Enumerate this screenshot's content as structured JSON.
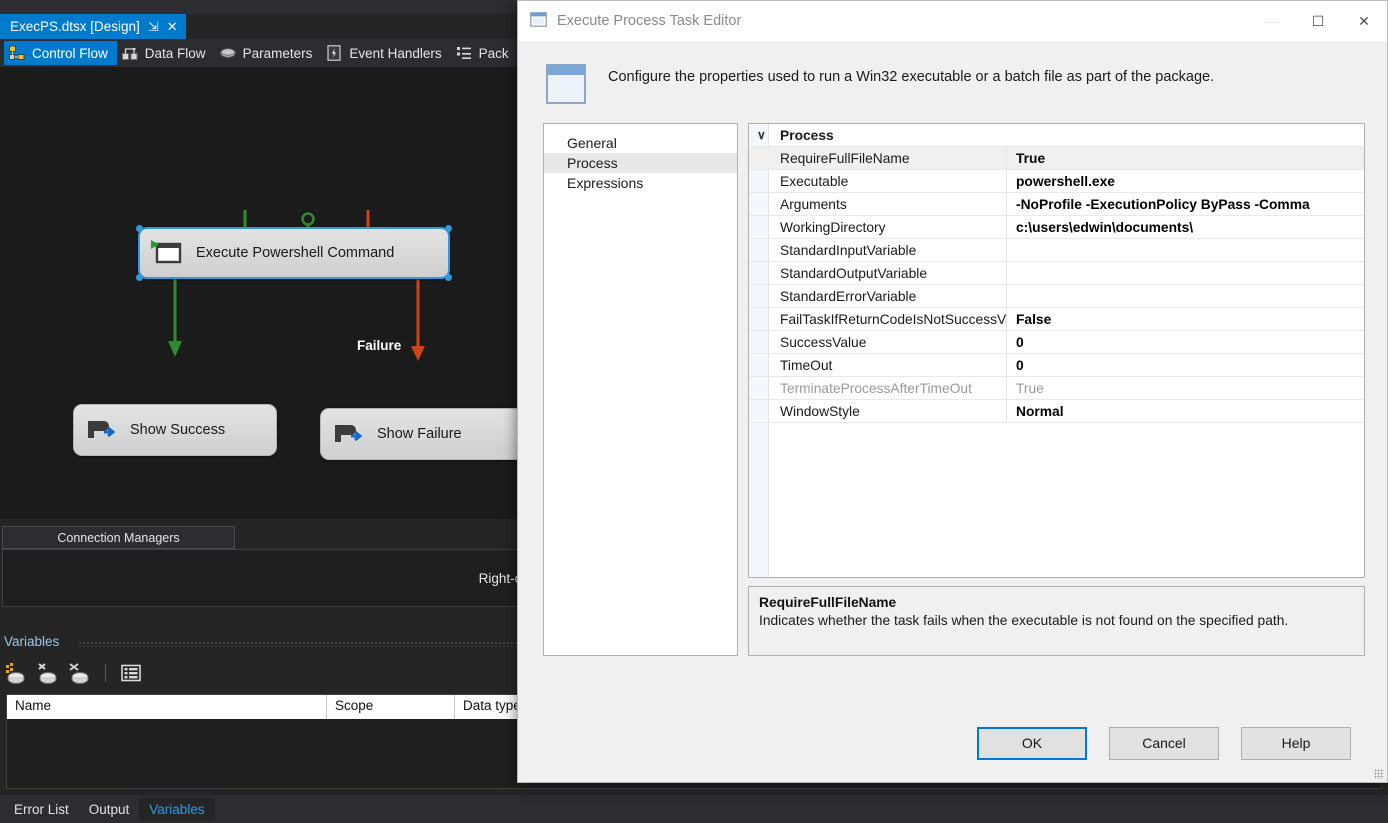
{
  "ide": {
    "document_tab": {
      "title": "ExecPS.dtsx [Design]",
      "pin_glyph": "⇲",
      "close_glyph": "✕"
    },
    "view_tabs": [
      {
        "label": "Control Flow",
        "icon": "control-flow-icon",
        "active": true
      },
      {
        "label": "Data Flow",
        "icon": "data-flow-icon",
        "active": false
      },
      {
        "label": "Parameters",
        "icon": "parameters-icon",
        "active": false
      },
      {
        "label": "Event Handlers",
        "icon": "event-handlers-icon",
        "active": false
      },
      {
        "label": "Pack",
        "icon": "package-explorer-icon",
        "active": false
      }
    ],
    "canvas": {
      "tasks": [
        {
          "label": "Execute Powershell Command",
          "icon": "execute-process-task-icon",
          "selected": true
        },
        {
          "label": "Show Success",
          "icon": "script-task-icon",
          "selected": false
        },
        {
          "label": "Show Failure",
          "icon": "script-task-icon",
          "selected": false
        }
      ],
      "precedence_labels": [
        "Failure"
      ],
      "success_color": "#2e8b2e",
      "failure_color": "#cf4315"
    },
    "connection_managers": {
      "tab_label": "Connection Managers",
      "hint": "Right-click here to add a new connection manager to the SSIS package."
    },
    "variables": {
      "title": "Variables",
      "close_glyph": "✕",
      "toolbar": [
        {
          "name": "add-variable-icon"
        },
        {
          "name": "delete-variable-icon"
        },
        {
          "name": "move-variable-icon"
        },
        {
          "name": "grid-options-icon"
        }
      ],
      "columns": [
        "Name",
        "Scope",
        "Data type"
      ]
    },
    "status_tabs": [
      {
        "label": "Error List",
        "active": false
      },
      {
        "label": "Output",
        "active": false
      },
      {
        "label": "Variables",
        "active": true
      }
    ],
    "gear_icon": "settings-gear-icon",
    "toolbox_icon": "toolbox-panel-icon",
    "accent_color": "#007acc"
  },
  "dialog": {
    "title": "Execute Process Task Editor",
    "title_icon": "window-app-icon",
    "window_controls": {
      "minimize": "—",
      "maximize": "☐",
      "close": "✕"
    },
    "header": {
      "icon": "execute-process-task-large-icon",
      "description": "Configure the properties used to run a Win32 executable or a batch file as part of the package."
    },
    "nav": {
      "items": [
        {
          "label": "General",
          "selected": false
        },
        {
          "label": "Process",
          "selected": true
        },
        {
          "label": "Expressions",
          "selected": false
        }
      ]
    },
    "grid": {
      "category": "Process",
      "collapse_glyph": "∨",
      "rows": [
        {
          "name": "RequireFullFileName",
          "value": "True",
          "selected": true,
          "dim": false
        },
        {
          "name": "Executable",
          "value": "powershell.exe",
          "selected": false,
          "dim": false
        },
        {
          "name": "Arguments",
          "value": "-NoProfile -ExecutionPolicy ByPass -Comma",
          "selected": false,
          "dim": false
        },
        {
          "name": "WorkingDirectory",
          "value": "c:\\users\\edwin\\documents\\",
          "selected": false,
          "dim": false
        },
        {
          "name": "StandardInputVariable",
          "value": "",
          "selected": false,
          "dim": false
        },
        {
          "name": "StandardOutputVariable",
          "value": "",
          "selected": false,
          "dim": false
        },
        {
          "name": "StandardErrorVariable",
          "value": "",
          "selected": false,
          "dim": false
        },
        {
          "name": "FailTaskIfReturnCodeIsNotSuccessValue",
          "value": "False",
          "selected": false,
          "dim": false
        },
        {
          "name": "SuccessValue",
          "value": "0",
          "selected": false,
          "dim": false
        },
        {
          "name": "TimeOut",
          "value": "0",
          "selected": false,
          "dim": false
        },
        {
          "name": "TerminateProcessAfterTimeOut",
          "value": "True",
          "selected": false,
          "dim": true
        },
        {
          "name": "WindowStyle",
          "value": "Normal",
          "selected": false,
          "dim": false
        }
      ]
    },
    "description": {
      "title": "RequireFullFileName",
      "text": "Indicates whether the task fails when the executable is not found on the specified path."
    },
    "buttons": [
      {
        "label": "OK",
        "default": true
      },
      {
        "label": "Cancel",
        "default": false
      },
      {
        "label": "Help",
        "default": false
      }
    ]
  }
}
